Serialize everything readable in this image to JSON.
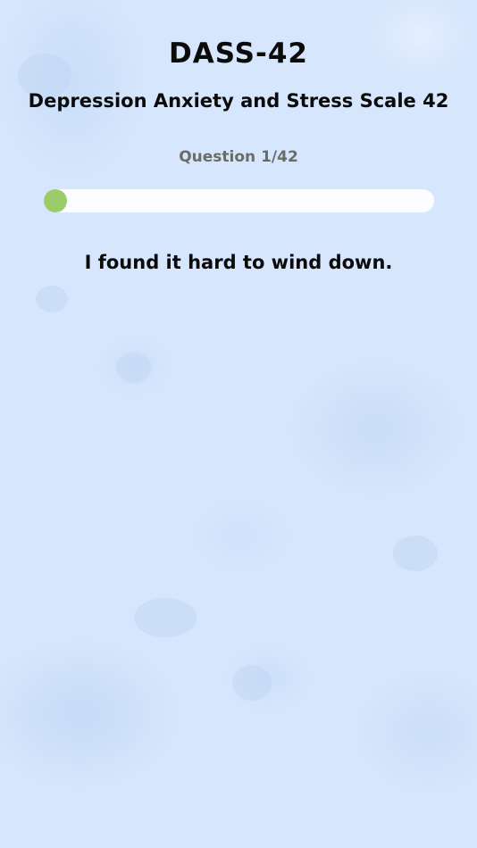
{
  "header": {
    "title": "DASS-42",
    "subtitle": "Depression Anxiety and Stress Scale 42"
  },
  "progress": {
    "label": "Question 1/42",
    "current": 1,
    "total": 42,
    "fraction": 0.0238
  },
  "question": {
    "text": "I found it hard to wind down."
  },
  "colors": {
    "background": "#d6e6fc",
    "progress_track": "#fbfdff",
    "progress_fill": "#9ccc6a",
    "text_primary": "#0b0b0b",
    "text_secondary": "#6b6b6b"
  }
}
